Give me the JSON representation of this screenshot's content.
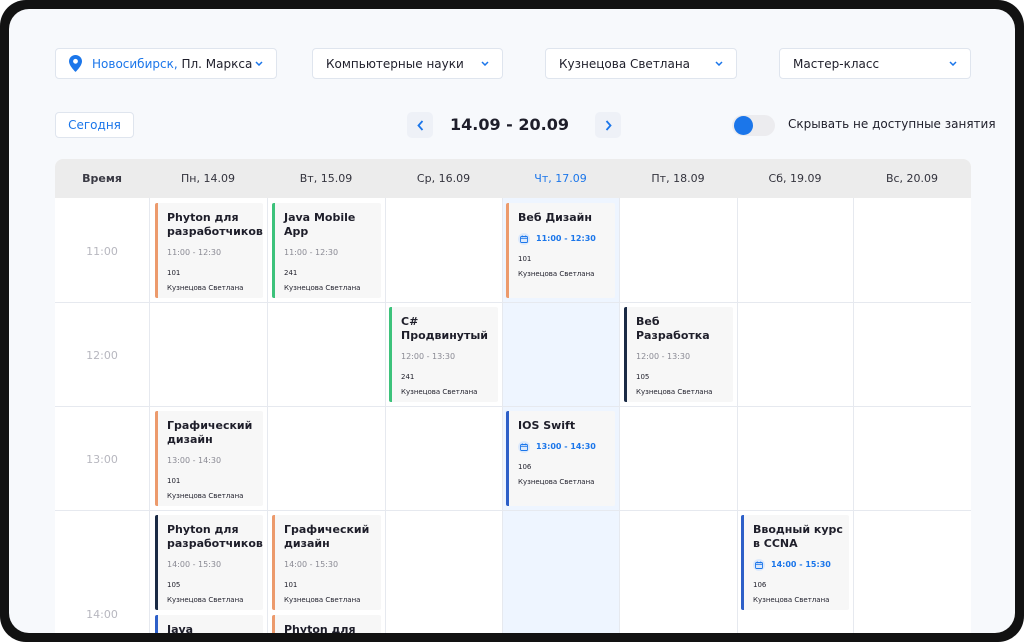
{
  "filters": {
    "location_city": "Новосибирск,",
    "location_place": "Пл. Маркса",
    "subject": "Компьютерные науки",
    "teacher": "Кузнецова Светлана",
    "format": "Мастер-класс"
  },
  "toolbar": {
    "today_label": "Сегодня",
    "date_range": "14.09 - 20.09",
    "hide_unavailable_label": "Скрывать не доступные занятия",
    "hide_unavailable_on": true
  },
  "calendar": {
    "time_header": "Время",
    "days": [
      "Пн, 14.09",
      "Вт, 15.09",
      "Ср, 16.09",
      "Чт, 17.09",
      "Пт, 18.09",
      "Сб, 19.09",
      "Вс, 20.09"
    ],
    "today_index": 3,
    "hours": [
      "11:00",
      "12:00",
      "13:00",
      "14:00"
    ]
  },
  "events": [
    {
      "title": "Phyton для разработчиков",
      "time": "11:00 - 12:30",
      "room": "101",
      "teacher": "Кузнецова Светлана",
      "color": "#ec9a6c",
      "live": false
    },
    {
      "title": "Java Mobile App",
      "time": "11:00 - 12:30",
      "room": "241",
      "teacher": "Кузнецова Светлана",
      "color": "#3cc27b",
      "live": false
    },
    {
      "title": "Веб Дизайн",
      "time": "11:00 - 12:30",
      "room": "101",
      "teacher": "Кузнецова Светлана",
      "color": "#ec9a6c",
      "live": true
    },
    {
      "title": "C# Продвинутый",
      "time": "12:00 - 13:30",
      "room": "241",
      "teacher": "Кузнецова Светлана",
      "color": "#3cc27b",
      "live": false
    },
    {
      "title": "Веб Разработка",
      "time": "12:00 - 13:30",
      "room": "105",
      "teacher": "Кузнецова Светлана",
      "color": "#1a2a44",
      "live": false
    },
    {
      "title": "Графический дизайн",
      "time": "13:00 - 14:30",
      "room": "101",
      "teacher": "Кузнецова Светлана",
      "color": "#ec9a6c",
      "live": false
    },
    {
      "title": "IOS Swift",
      "time": "13:00 - 14:30",
      "room": "106",
      "teacher": "Кузнецова Светлана",
      "color": "#2d5fc8",
      "live": true
    },
    {
      "title": "Phyton для разработчиков",
      "time": "14:00 - 15:30",
      "room": "105",
      "teacher": "Кузнецова Светлана",
      "color": "#1a2a44",
      "live": false
    },
    {
      "title": "Графический дизайн",
      "time": "14:00 - 15:30",
      "room": "101",
      "teacher": "Кузнецова Светлана",
      "color": "#ec9a6c",
      "live": false
    },
    {
      "title": "Вводный курс в CCNA",
      "time": "14:00 - 15:30",
      "room": "106",
      "teacher": "Кузнецова Светлана",
      "color": "#2d5fc8",
      "live": true
    },
    {
      "title": "Java",
      "time": "",
      "room": "",
      "teacher": "",
      "color": "#2d5fc8",
      "live": false
    },
    {
      "title": "Phyton для",
      "time": "",
      "room": "",
      "teacher": "",
      "color": "#ec9a6c",
      "live": false
    }
  ]
}
